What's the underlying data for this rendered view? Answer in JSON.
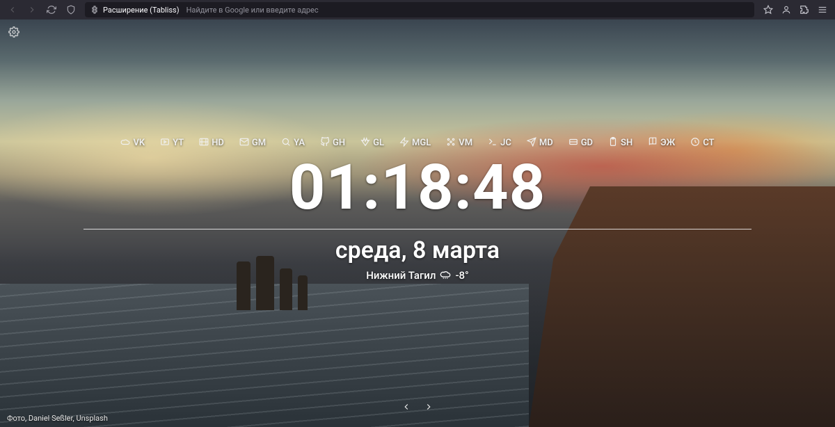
{
  "chrome": {
    "extension_label": "Расширение (Tabliss)",
    "url_placeholder": "Найдите в Google или введите адрес"
  },
  "quicklinks": [
    {
      "icon": "cloud",
      "label": "VK"
    },
    {
      "icon": "play",
      "label": "YT"
    },
    {
      "icon": "film",
      "label": "HD"
    },
    {
      "icon": "mail",
      "label": "GM"
    },
    {
      "icon": "search",
      "label": "YA"
    },
    {
      "icon": "github",
      "label": "GH"
    },
    {
      "icon": "gitlab",
      "label": "GL"
    },
    {
      "icon": "zap",
      "label": "MGL"
    },
    {
      "icon": "slack",
      "label": "VM"
    },
    {
      "icon": "terminal",
      "label": "JC"
    },
    {
      "icon": "send",
      "label": "MD"
    },
    {
      "icon": "drive",
      "label": "GD"
    },
    {
      "icon": "clipboard",
      "label": "SH"
    },
    {
      "icon": "book",
      "label": "ЭЖ"
    },
    {
      "icon": "clock",
      "label": "CT"
    }
  ],
  "clock": "01:18:48",
  "date": "среда, 8 марта",
  "weather": {
    "location": "Нижний Тагил",
    "temp": "-8°"
  },
  "credit": "Фото, Daniel Seßler, Unsplash"
}
